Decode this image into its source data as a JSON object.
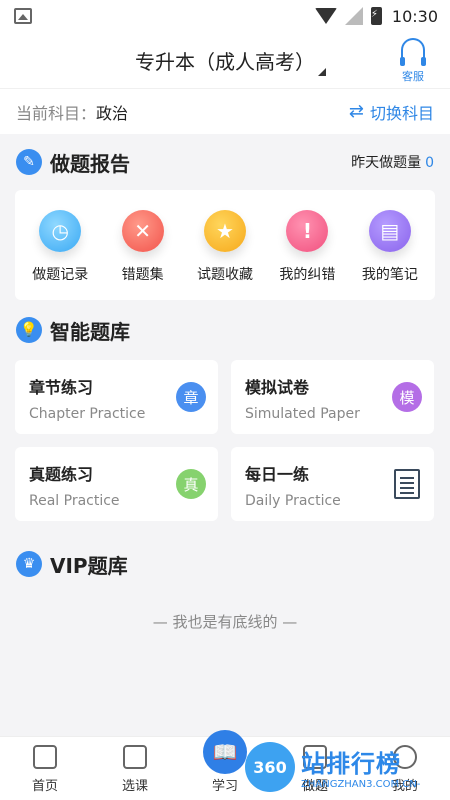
{
  "statusbar": {
    "time": "10:30"
  },
  "header": {
    "title": "专升本（成人高考）",
    "service_label": "客服"
  },
  "subject": {
    "label": "当前科目：",
    "value": "政治",
    "switch_label": "切换科目"
  },
  "report": {
    "title": "做题报告",
    "yesterday_label": "昨天做题量",
    "yesterday_count": "0",
    "items": [
      {
        "label": "做题记录",
        "icon": "clock-icon"
      },
      {
        "label": "错题集",
        "icon": "x-icon"
      },
      {
        "label": "试题收藏",
        "icon": "star-icon"
      },
      {
        "label": "我的纠错",
        "icon": "exclamation-icon"
      },
      {
        "label": "我的笔记",
        "icon": "note-icon"
      }
    ]
  },
  "bank": {
    "title": "智能题库",
    "cards": [
      {
        "title": "章节练习",
        "subtitle": "Chapter Practice",
        "badge": "章"
      },
      {
        "title": "模拟试卷",
        "subtitle": "Simulated Paper",
        "badge": "模"
      },
      {
        "title": "真题练习",
        "subtitle": "Real Practice",
        "badge": "真"
      },
      {
        "title": "每日一练",
        "subtitle": "Daily Practice",
        "badge": ""
      }
    ]
  },
  "vip": {
    "title": "VIP题库"
  },
  "bottom_note": "— 我也是有底线的 —",
  "tabs": [
    {
      "label": "首页"
    },
    {
      "label": "选课"
    },
    {
      "label": "学习"
    },
    {
      "label": "做题"
    },
    {
      "label": "我的"
    }
  ],
  "watermark": {
    "logo": "360",
    "text": "站排行榜",
    "small": "ZHANGZHAN3.COM.CN-"
  }
}
